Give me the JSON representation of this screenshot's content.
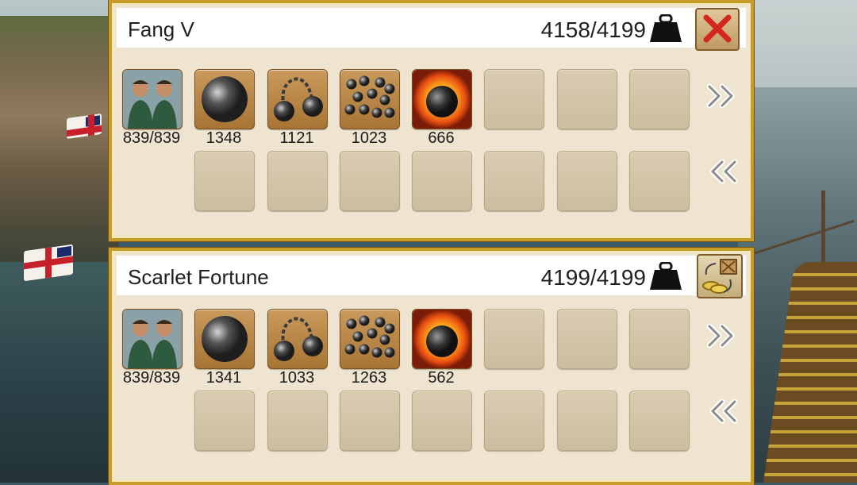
{
  "panels": [
    {
      "ship_name": "Fang V",
      "cargo": "4158/4199",
      "crew_count": "839/839",
      "slot_counts": [
        "1348",
        "1121",
        "1023",
        "666"
      ],
      "items": [
        "cannonball-icon",
        "chain-shot-icon",
        "grapeshot-icon",
        "fire-ball-icon"
      ],
      "corner_button": "close-icon"
    },
    {
      "ship_name": "Scarlet Fortune",
      "cargo": "4199/4199",
      "crew_count": "839/839",
      "slot_counts": [
        "1341",
        "1033",
        "1263",
        "562"
      ],
      "items": [
        "cannonball-icon",
        "chain-shot-icon",
        "grapeshot-icon",
        "fire-ball-icon"
      ],
      "corner_button": "trade-crate-coins-icon"
    }
  ],
  "icons": {
    "weight": "weight-icon",
    "transfer_right": "double-chevron-right-icon",
    "transfer_left": "double-chevron-left-icon",
    "crew": "crew-portrait-icon"
  },
  "colors": {
    "frame_gold": "#c99b2a",
    "panel_bg": "#efe6d2",
    "close_red": "#d4261f"
  }
}
